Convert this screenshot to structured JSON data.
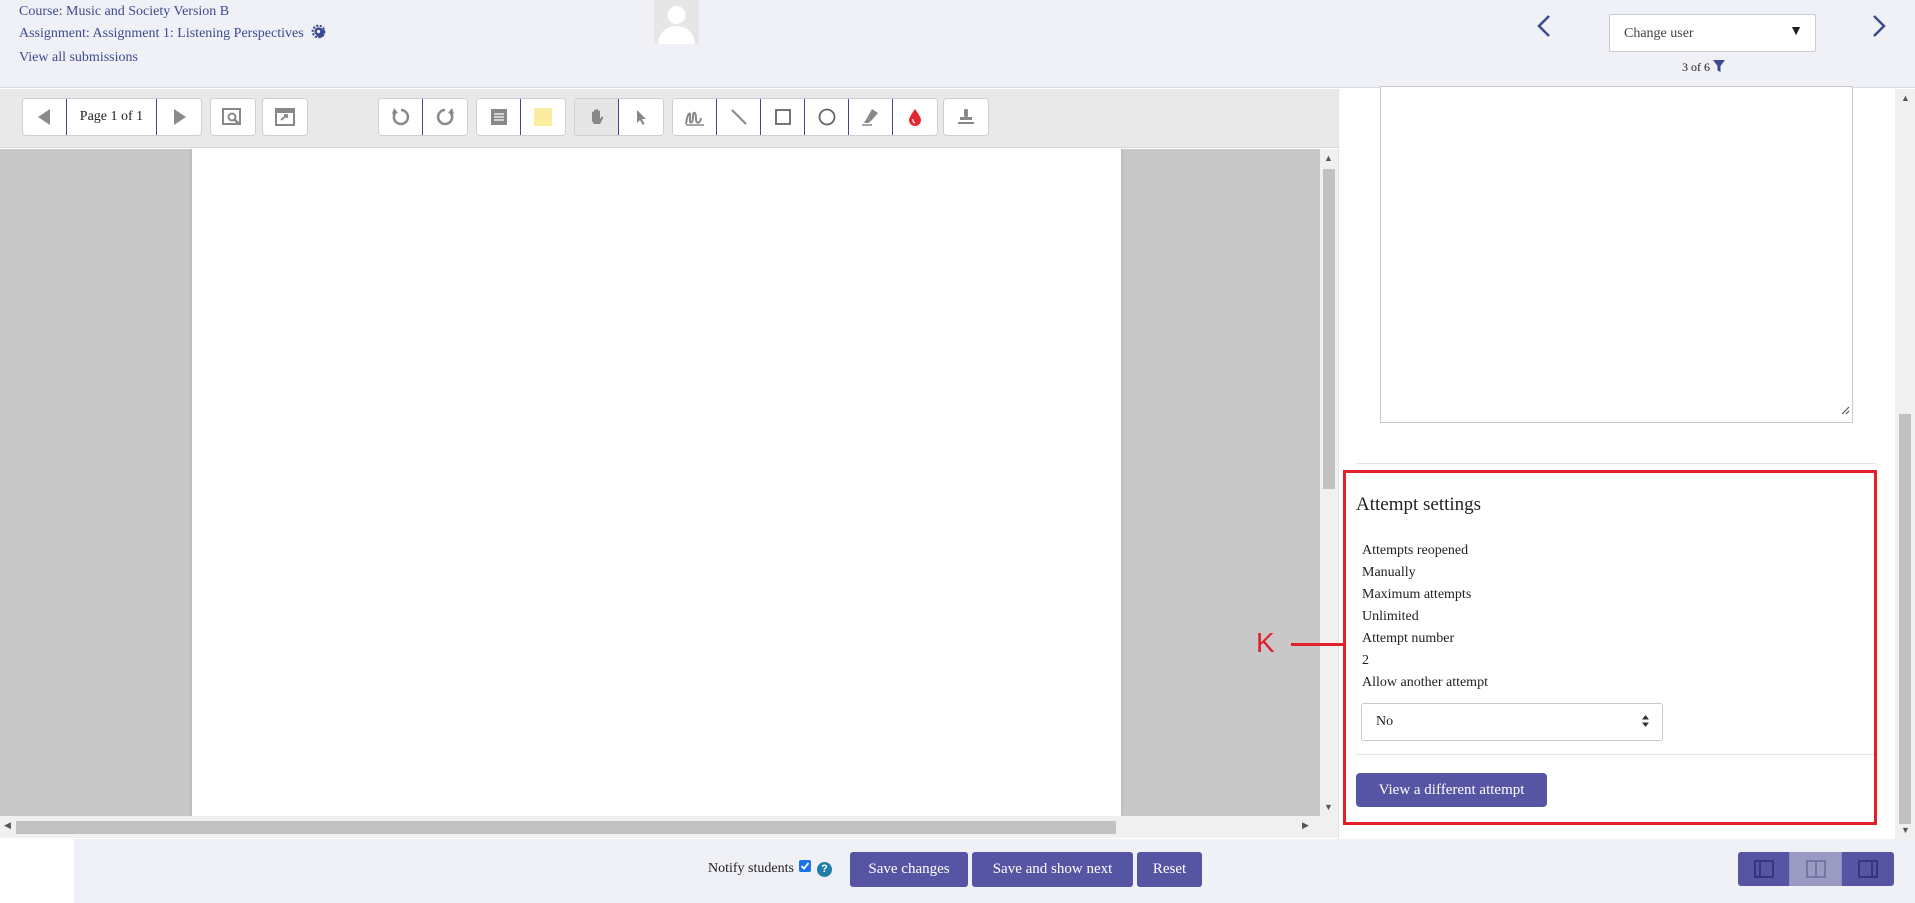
{
  "header": {
    "course": "Course: Music and Society Version B",
    "assignment": "Assignment: Assignment 1: Listening Perspectives",
    "view_all": "View all submissions",
    "change_user": "Change user",
    "user_count": "3 of 6"
  },
  "toolbar": {
    "page_label": "Page 1 of 1"
  },
  "attempt_settings": {
    "title": "Attempt settings",
    "reopened_label": "Attempts reopened",
    "reopened_value": "Manually",
    "max_label": "Maximum attempts",
    "max_value": "Unlimited",
    "number_label": "Attempt number",
    "number_value": "2",
    "allow_label": "Allow another attempt",
    "allow_value": "No",
    "view_button": "View a different attempt"
  },
  "annotation": {
    "label": "K",
    "color": "#e0202b"
  },
  "footer": {
    "notify_label": "Notify students",
    "notify_checked": true,
    "save_changes": "Save changes",
    "save_next": "Save and show next",
    "reset": "Reset"
  },
  "colors": {
    "primary_button": "#5555a3",
    "link": "#3d4a8f",
    "highlight_box": "#e0202b"
  }
}
